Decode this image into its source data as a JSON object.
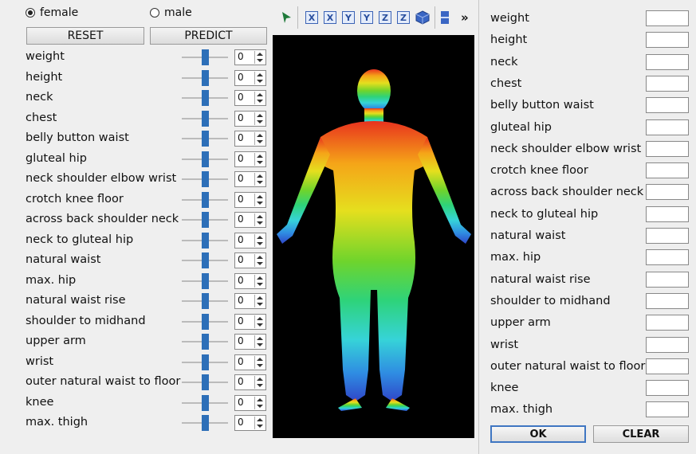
{
  "gender": {
    "options": [
      "female",
      "male"
    ],
    "selected": "female"
  },
  "buttons": {
    "reset": "RESET",
    "predict": "PREDICT",
    "ok": "OK",
    "clear": "CLEAR"
  },
  "measurements": [
    {
      "label": "weight",
      "value": "0"
    },
    {
      "label": "height",
      "value": "0"
    },
    {
      "label": "neck",
      "value": "0"
    },
    {
      "label": "chest",
      "value": "0"
    },
    {
      "label": "belly button waist",
      "value": "0"
    },
    {
      "label": "gluteal hip",
      "value": "0"
    },
    {
      "label": "neck shoulder elbow wrist",
      "value": "0"
    },
    {
      "label": "crotch knee floor",
      "value": "0"
    },
    {
      "label": "across back shoulder neck",
      "value": "0"
    },
    {
      "label": "neck to gluteal hip",
      "value": "0"
    },
    {
      "label": "natural waist",
      "value": "0"
    },
    {
      "label": "max. hip",
      "value": "0"
    },
    {
      "label": "natural waist rise",
      "value": "0"
    },
    {
      "label": "shoulder to midhand",
      "value": "0"
    },
    {
      "label": "upper arm",
      "value": "0"
    },
    {
      "label": "wrist",
      "value": "0"
    },
    {
      "label": "outer natural waist to floor",
      "value": "0"
    },
    {
      "label": "knee",
      "value": "0"
    },
    {
      "label": "max. thigh",
      "value": "0"
    }
  ],
  "slider_position": 0.5,
  "toolbar": {
    "icons": [
      "pick-icon",
      "x-axis-icon",
      "x-axis-reverse-icon",
      "y-axis-icon",
      "y-axis-reverse-icon",
      "z-axis-icon",
      "z-axis-reverse-icon",
      "cube-icon",
      "panel-icon"
    ],
    "axis_labels": [
      "X",
      "X",
      "Y",
      "Y",
      "Z",
      "Z"
    ],
    "more_label": "»"
  },
  "right_fields": [
    {
      "label": "weight",
      "value": ""
    },
    {
      "label": "height",
      "value": ""
    },
    {
      "label": "neck",
      "value": ""
    },
    {
      "label": "chest",
      "value": ""
    },
    {
      "label": "belly button waist",
      "value": ""
    },
    {
      "label": "gluteal hip",
      "value": ""
    },
    {
      "label": "neck shoulder elbow wrist",
      "value": ""
    },
    {
      "label": "crotch knee floor",
      "value": ""
    },
    {
      "label": "across back shoulder neck",
      "value": ""
    },
    {
      "label": "neck to gluteal hip",
      "value": ""
    },
    {
      "label": "natural waist",
      "value": ""
    },
    {
      "label": "max. hip",
      "value": ""
    },
    {
      "label": "natural waist rise",
      "value": ""
    },
    {
      "label": "shoulder to midhand",
      "value": ""
    },
    {
      "label": "upper arm",
      "value": ""
    },
    {
      "label": "wrist",
      "value": ""
    },
    {
      "label": "outer natural waist to floor",
      "value": ""
    },
    {
      "label": "knee",
      "value": ""
    },
    {
      "label": "max. thigh",
      "value": ""
    }
  ],
  "colors": {
    "accent": "#2d6fb8",
    "viewer_bg": "#000000"
  }
}
